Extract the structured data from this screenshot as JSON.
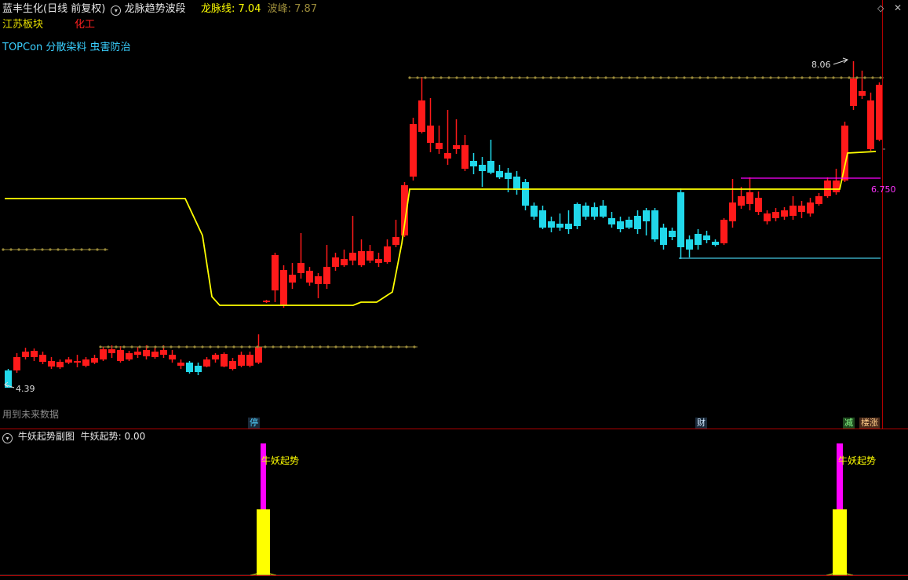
{
  "header": {
    "stock_name": "蓝丰生化(日线 前复权)",
    "indicator_name": "龙脉趋势波段",
    "line_label": "龙脉线:",
    "line_value": "7.04",
    "peak_label": "波峰:",
    "peak_value": "7.87"
  },
  "tags": {
    "region": "江苏板块",
    "industry": "化工",
    "concepts": "TOPCon 分散染料 虫害防治"
  },
  "chart_labels": {
    "high_price": "8.06",
    "low_price": "4.39",
    "level_price": "6.750",
    "future_data_note": "用到未来数据"
  },
  "markers": {
    "stop": "停",
    "finance": "财",
    "reduce": "减",
    "limit_up": "楼涨"
  },
  "sub_panel": {
    "title": "牛妖起势副图",
    "value_label": "牛妖起势:",
    "value": "0.00",
    "signal_label": "牛妖起势"
  },
  "colors": {
    "up": "#ff1a1a",
    "down": "#21d8ea",
    "trend_line": "#ffff00",
    "dots": "#9a8a3a",
    "magenta": "#ff00ff",
    "border": "#b00000"
  },
  "icons": {
    "collapse": "circle-chevron-down-icon",
    "diamond": "diamond-icon",
    "close": "close-icon"
  }
}
